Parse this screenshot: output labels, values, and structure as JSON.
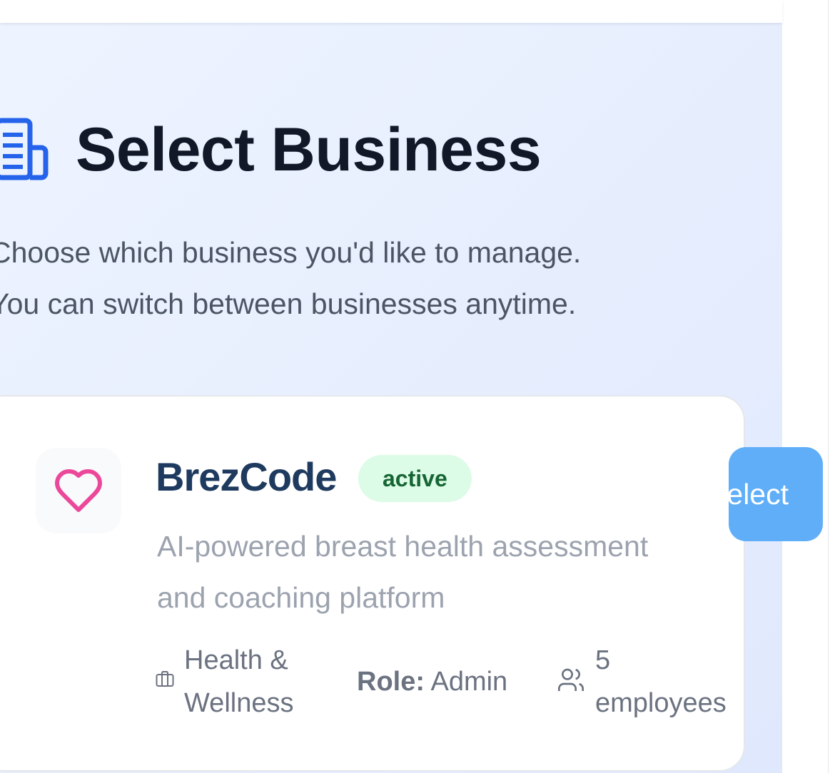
{
  "header": {
    "title": "Select Business",
    "icon": "building-icon",
    "subtitle_lines": [
      "Choose which business you'd like to manage.",
      "You can switch between businesses anytime."
    ]
  },
  "business": {
    "name": "BrezCode",
    "status": "active",
    "logo_icon": "heart-icon",
    "description_lines": [
      "AI-powered breast health assessment",
      "and coaching platform"
    ],
    "industry_lines": [
      "Health &",
      "Wellness"
    ],
    "role_label": "Role:",
    "role_value": "Admin",
    "employees_lines": [
      "5",
      "employees"
    ],
    "select_label": "Select"
  },
  "colors": {
    "accent": "#2563eb",
    "heart": "#ec4899",
    "status_bg": "#dcfce7",
    "status_text": "#166534",
    "select_button": "#60aef8",
    "title": "#111827"
  }
}
